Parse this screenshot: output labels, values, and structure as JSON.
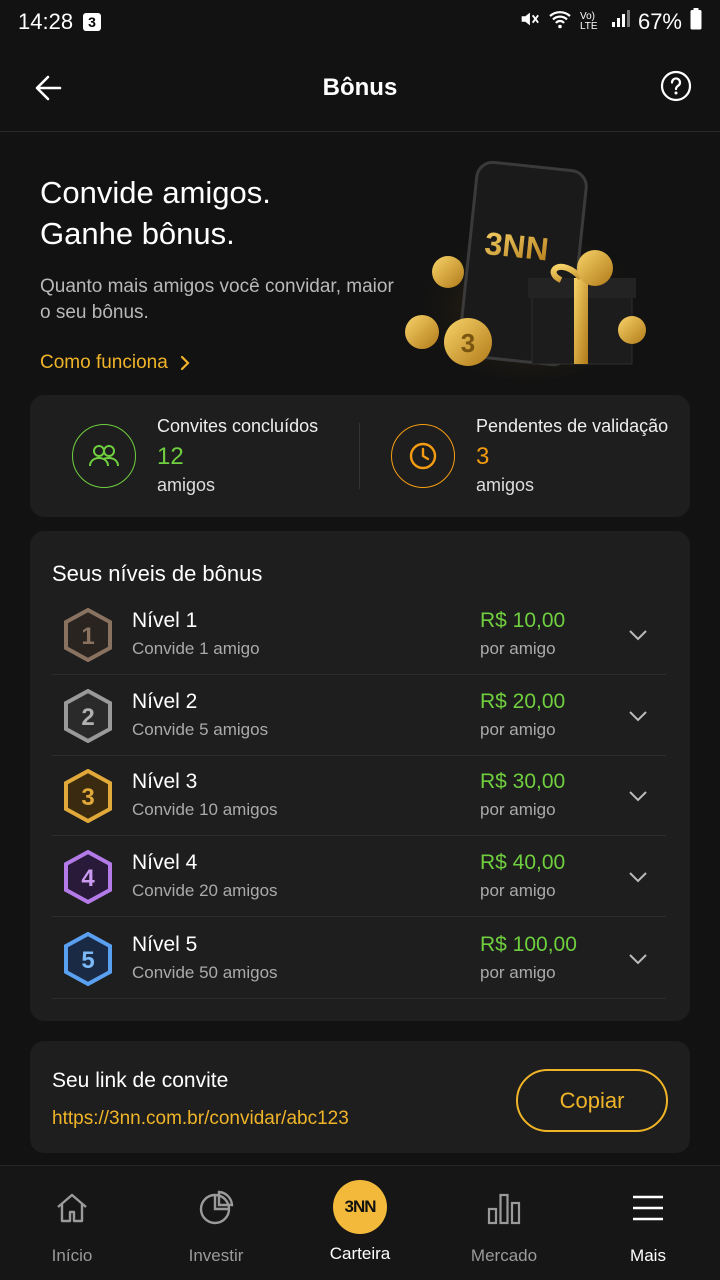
{
  "status_bar": {
    "time": "14:28",
    "notif_count": "3",
    "network": "Vo) LTE",
    "battery": "67%"
  },
  "app_bar": {
    "title": "Bônus"
  },
  "hero": {
    "title_line1": "Convide amigos.",
    "title_line2": "Ganhe bônus.",
    "subtitle": "Quanto mais amigos você convidar, maior o seu bônus.",
    "link_label": "Como funciona",
    "art_brand": "3NN",
    "art_coin": "3"
  },
  "stats": {
    "completed": {
      "label": "Convites concluídos",
      "value": "12",
      "unit": "amigos",
      "color": "#6fcf3f"
    },
    "pending": {
      "label": "Pendentes de validação",
      "value": "3",
      "unit": "amigos",
      "color": "#f39c12"
    }
  },
  "levels": {
    "title": "Seus níveis de bônus",
    "items": [
      {
        "badge": "1",
        "title": "Nível 1",
        "subtitle": "Convide 1 amigo",
        "amount": "R$ 10,00",
        "per": "por amigo",
        "color": "#8a7260"
      },
      {
        "badge": "2",
        "title": "Nível 2",
        "subtitle": "Convide 5 amigos",
        "amount": "R$ 20,00",
        "per": "por amigo",
        "color": "#9a9a9a"
      },
      {
        "badge": "3",
        "title": "Nível 3",
        "subtitle": "Convide 10 amigos",
        "amount": "R$ 30,00",
        "per": "por amigo",
        "color": "#e0a93a"
      },
      {
        "badge": "4",
        "title": "Nível 4",
        "subtitle": "Convide 20 amigos",
        "amount": "R$ 40,00",
        "per": "por amigo",
        "color": "#b47ae8"
      },
      {
        "badge": "5",
        "title": "Nível 5",
        "subtitle": "Convide 50 amigos",
        "amount": "R$ 100,00",
        "per": "por amigo",
        "color": "#5aa0f0"
      }
    ]
  },
  "invite": {
    "label": "Seu link de convite",
    "link": "https://3nn.com.br/convidar/abc123",
    "copy_label": "Copiar"
  },
  "bottom_nav": [
    {
      "label": "Início",
      "icon": "home-icon"
    },
    {
      "label": "Investir",
      "icon": "pie-chart-icon"
    },
    {
      "label": "Carteira",
      "icon": "3nn-logo"
    },
    {
      "label": "Mercado",
      "icon": "bar-chart-icon"
    },
    {
      "label": "Mais",
      "icon": "menu-icon"
    }
  ],
  "colors": {
    "accent": "#f0b429",
    "positive": "#6fcf3f",
    "pending": "#f39c12",
    "background": "#121212",
    "card": "#1e1e1e"
  }
}
